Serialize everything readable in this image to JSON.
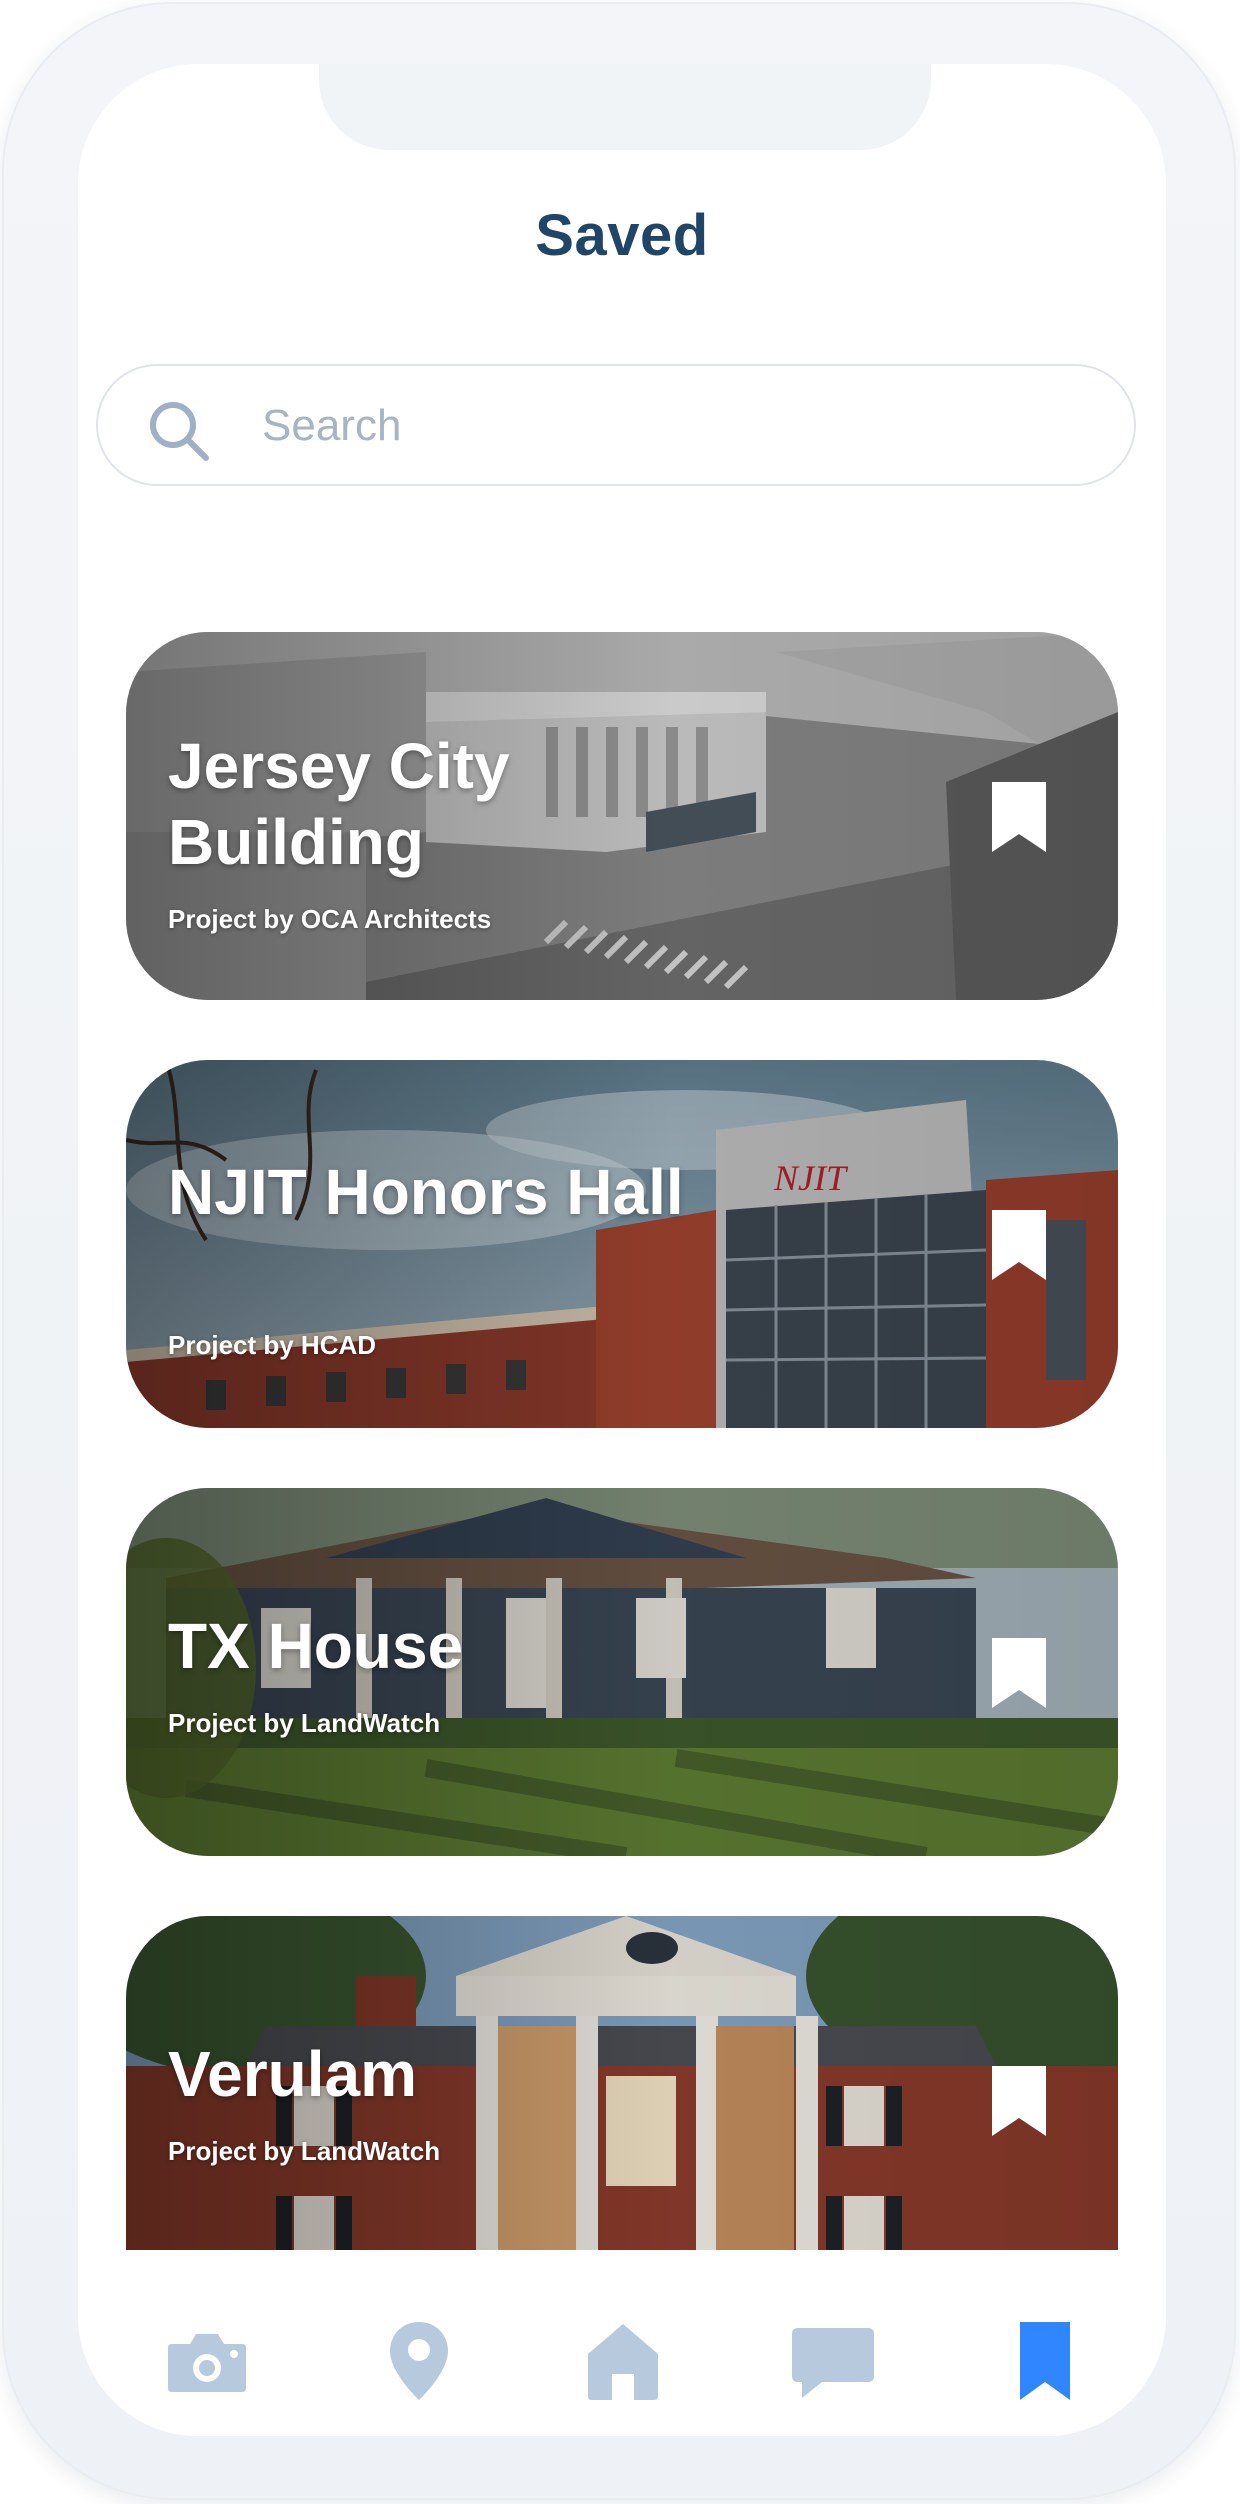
{
  "header": {
    "title": "Saved"
  },
  "search": {
    "placeholder": "Search",
    "value": ""
  },
  "cards": [
    {
      "title": "Jersey City Building",
      "subtitle": "Project by OCA Architects"
    },
    {
      "title": "NJIT Honors Hall",
      "subtitle": "Project by HCAD"
    },
    {
      "title": "TX House",
      "subtitle": "Project by LandWatch"
    },
    {
      "title": "Verulam",
      "subtitle": "Project by LandWatch"
    }
  ],
  "tabbar": {
    "items": [
      {
        "icon": "camera-icon",
        "active": false
      },
      {
        "icon": "map-pin-icon",
        "active": false
      },
      {
        "icon": "home-icon",
        "active": false
      },
      {
        "icon": "chat-icon",
        "active": false
      },
      {
        "icon": "bookmark-icon",
        "active": true
      }
    ],
    "active_color": "#2f86ff",
    "inactive_color": "#b7c9dd"
  },
  "colors": {
    "title": "#1f4568",
    "placeholder": "#a7b4c4"
  }
}
